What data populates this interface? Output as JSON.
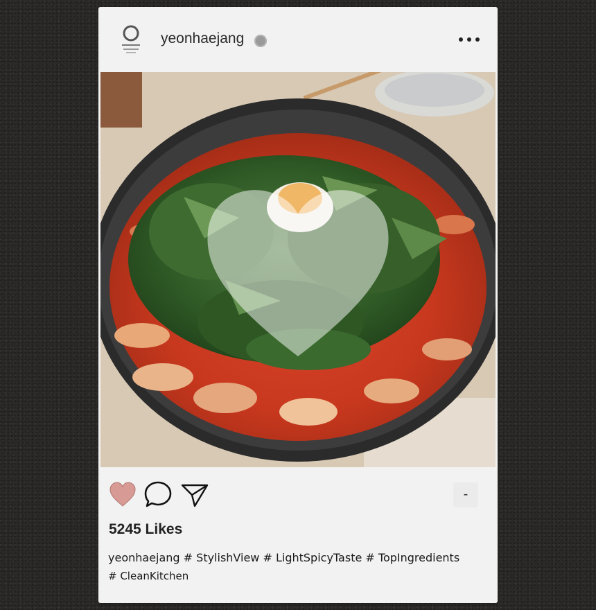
{
  "post": {
    "username": "yeonhaejang",
    "avatar_logo": "연해장",
    "more_icon": "more-dots-icon",
    "likes_text": "5245 Likes",
    "caption_line1": "yeonhaejang # StylishView # LightSpicyTaste # TopIngredients",
    "caption_line2": "# CleanKitchen",
    "bookmark_label": "-"
  },
  "colors": {
    "card_bg": "#f2f2f2",
    "page_bg": "#2b2927",
    "heart_fill": "#d79a95",
    "verified_badge": "#9a9a9a"
  },
  "icons": {
    "like": "heart-icon",
    "comment": "comment-bubble-icon",
    "share": "send-paper-plane-icon",
    "overlay": "heart-overlay-icon"
  }
}
